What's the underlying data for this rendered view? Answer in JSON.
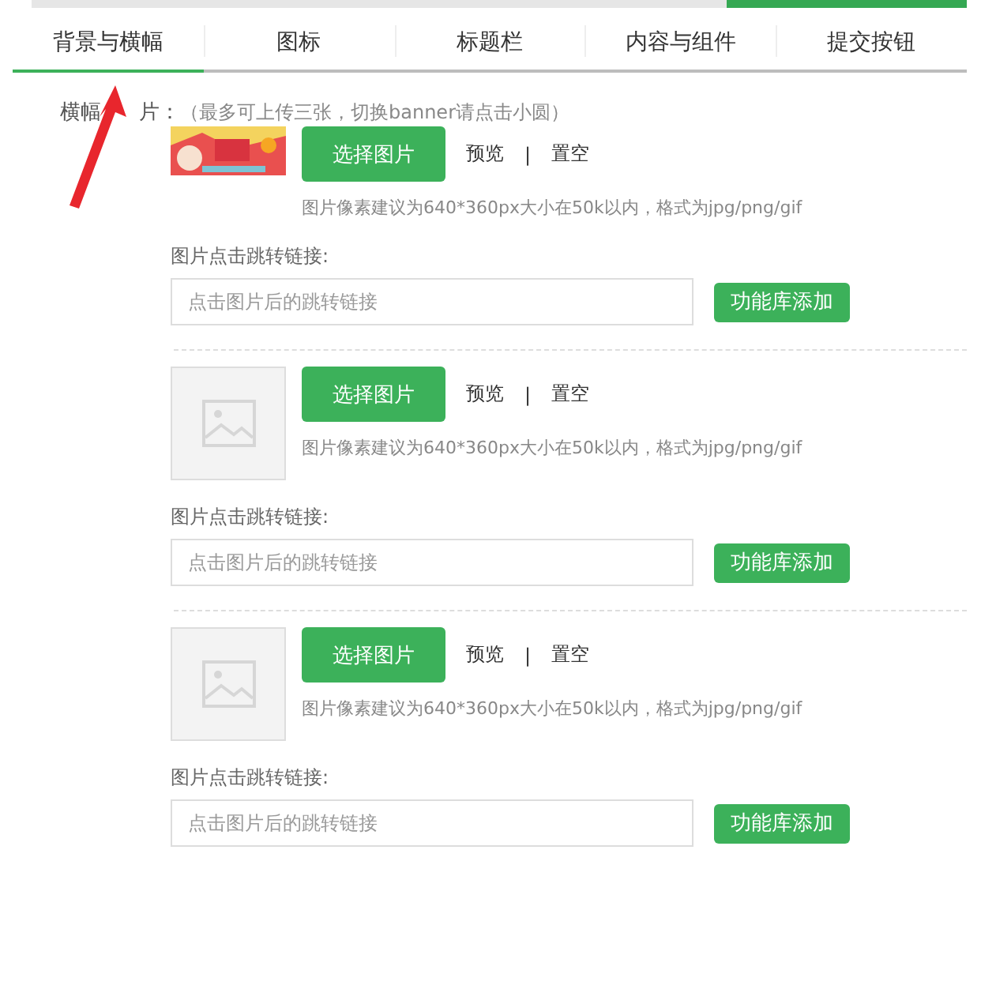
{
  "tabs": [
    {
      "label": "背景与横幅",
      "selected": true
    },
    {
      "label": "图标",
      "selected": false
    },
    {
      "label": "标题栏",
      "selected": false
    },
    {
      "label": "内容与组件",
      "selected": false
    },
    {
      "label": "提交按钮",
      "selected": false
    }
  ],
  "section_label": {
    "before_arrow": "横幅",
    "after_arrow": "片：",
    "note": "（最多可上传三张，切换banner请点击小圆）"
  },
  "banners": [
    {
      "kind": "picture",
      "choose_button": "选择图片",
      "preview_link": "预览",
      "separator": "|",
      "clear_link": "置空",
      "hint": "图片像素建议为640*360px大小在50k以内，格式为jpg/png/gif",
      "link_label": "图片点击跳转链接:",
      "link_placeholder": "点击图片后的跳转链接",
      "add_button": "功能库添加"
    },
    {
      "kind": "empty",
      "choose_button": "选择图片",
      "preview_link": "预览",
      "separator": "|",
      "clear_link": "置空",
      "hint": "图片像素建议为640*360px大小在50k以内，格式为jpg/png/gif",
      "link_label": "图片点击跳转链接:",
      "link_placeholder": "点击图片后的跳转链接",
      "add_button": "功能库添加"
    },
    {
      "kind": "empty",
      "choose_button": "选择图片",
      "preview_link": "预览",
      "separator": "|",
      "clear_link": "置空",
      "hint": "图片像素建议为640*360px大小在50k以内，格式为jpg/png/gif",
      "link_label": "图片点击跳转链接:",
      "link_placeholder": "点击图片后的跳转链接",
      "add_button": "功能库添加"
    }
  ]
}
